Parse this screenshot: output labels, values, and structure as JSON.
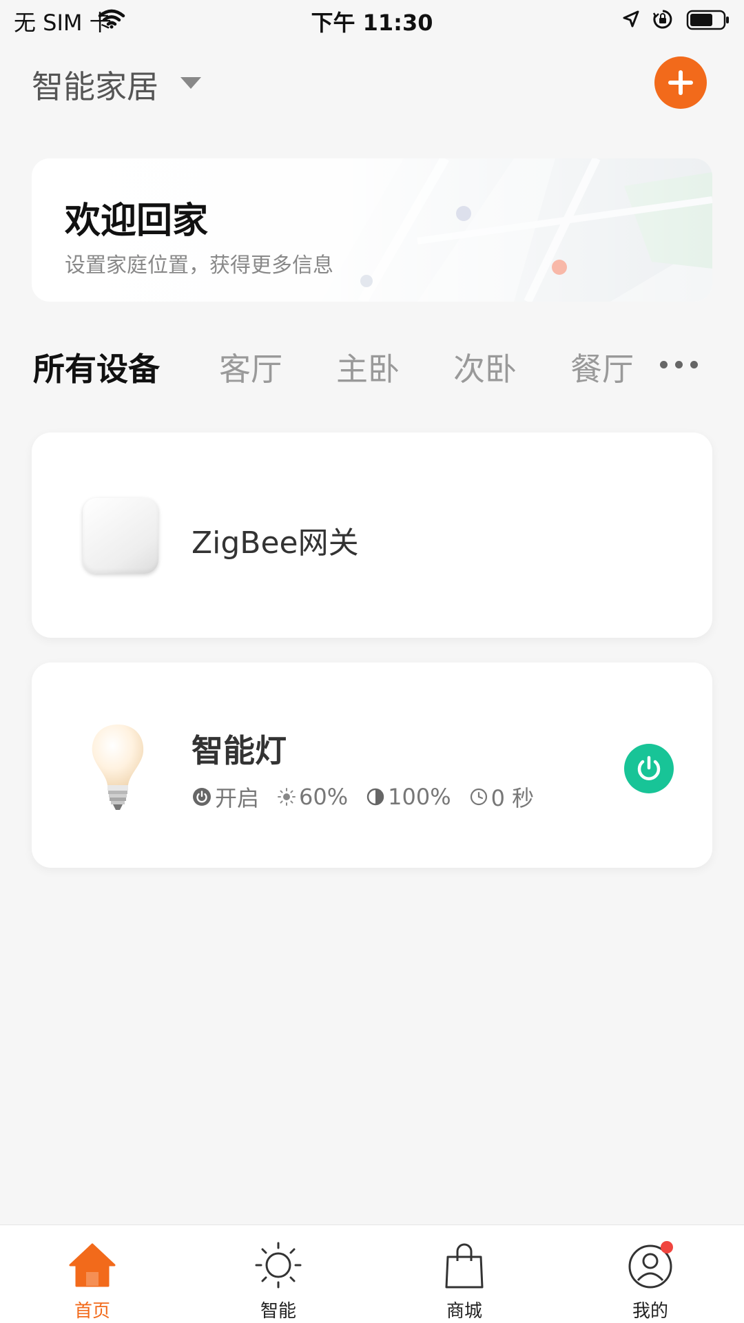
{
  "status_bar": {
    "carrier": "无 SIM 卡",
    "time": "下午 11:30"
  },
  "header": {
    "home_name": "智能家居"
  },
  "welcome": {
    "title": "欢迎回家",
    "subtitle": "设置家庭位置，获得更多信息"
  },
  "rooms": {
    "tabs": [
      "所有设备",
      "客厅",
      "主卧",
      "次卧",
      "餐厅"
    ],
    "selected": "所有设备"
  },
  "devices": [
    {
      "name": "ZigBee网关"
    },
    {
      "name": "智能灯",
      "power_state": "开启",
      "brightness": "60%",
      "contrast": "100%",
      "timer": "0 秒",
      "power_on": true
    }
  ],
  "tab_bar": {
    "items": [
      {
        "label": "首页",
        "icon": "home-icon",
        "active": true
      },
      {
        "label": "智能",
        "icon": "sun-icon",
        "active": false
      },
      {
        "label": "商城",
        "icon": "shopping-bag-icon",
        "active": false
      },
      {
        "label": "我的",
        "icon": "profile-icon",
        "active": false,
        "badge": true
      }
    ]
  },
  "colors": {
    "accent": "#f26a1b",
    "power_on": "#18c497",
    "badge": "#f0453f"
  }
}
